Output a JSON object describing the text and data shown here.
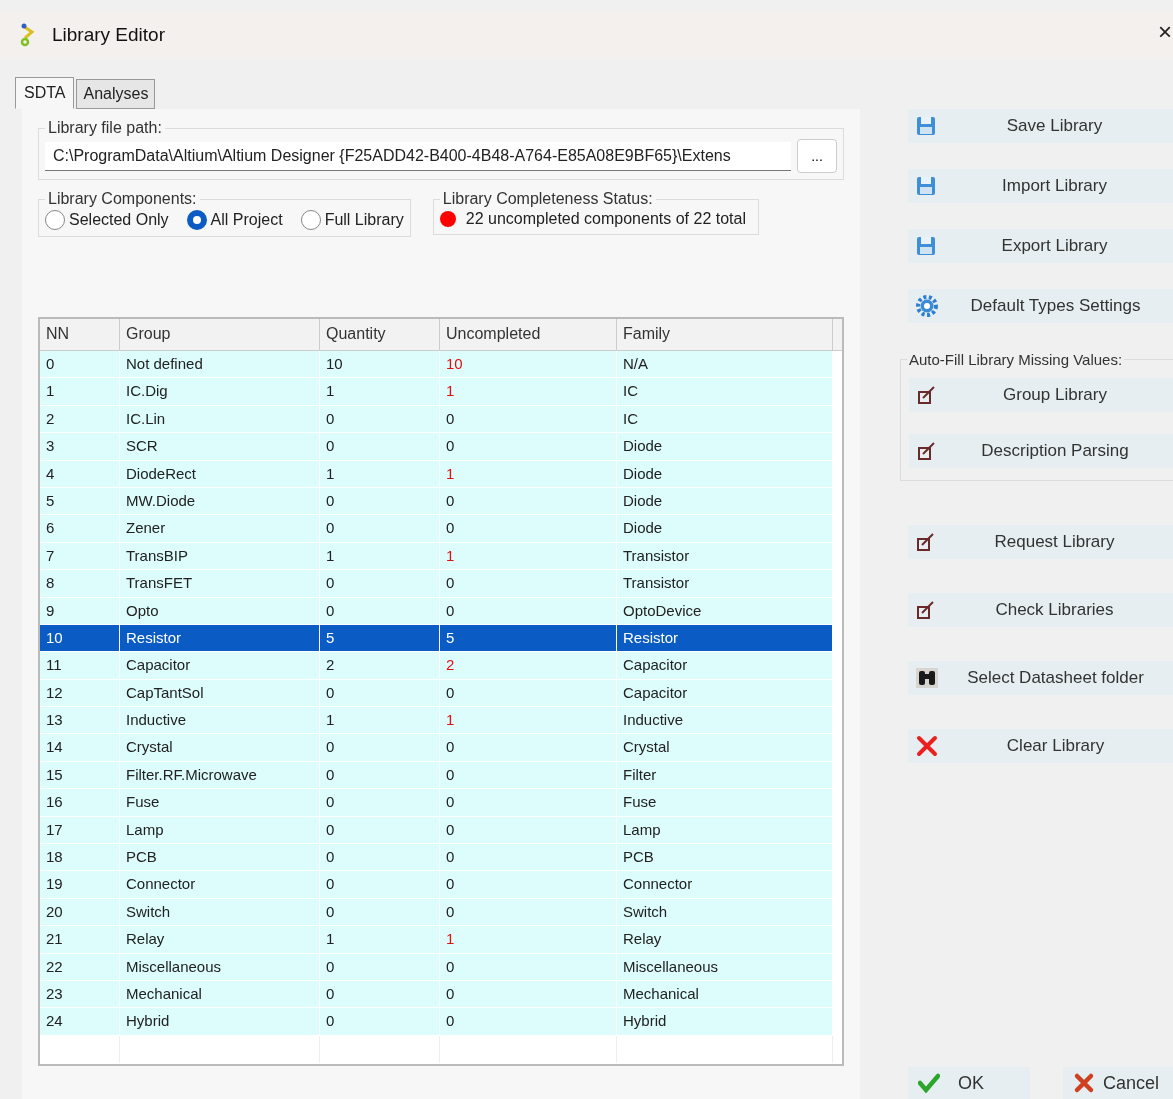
{
  "window": {
    "title": "Library Editor",
    "close": "×"
  },
  "tabs": [
    {
      "label": "SDTA",
      "selected": true
    },
    {
      "label": "Analyses",
      "selected": false
    }
  ],
  "file_path": {
    "label": "Library file path:",
    "value": "C:\\ProgramData\\Altium\\Altium Designer {F25ADD42-B400-4B48-A764-E85A08E9BF65}\\Extens",
    "browse": "..."
  },
  "components": {
    "label": "Library Components:",
    "options": [
      {
        "label": "Selected Only",
        "selected": false
      },
      {
        "label": "All Project",
        "selected": true
      },
      {
        "label": "Full Library",
        "selected": false
      }
    ]
  },
  "status": {
    "label": "Library Completeness Status:",
    "text": "22 uncompleted components of 22 total",
    "color": "#ff0000"
  },
  "table": {
    "columns": [
      "NN",
      "Group",
      "Quantity",
      "Uncompleted",
      "Family"
    ],
    "rows": [
      {
        "cells": [
          "0",
          "Not defined",
          "10",
          "10",
          "N/A"
        ],
        "flagged": true,
        "selected": false
      },
      {
        "cells": [
          "1",
          "IC.Dig",
          "1",
          "1",
          "IC"
        ],
        "flagged": true,
        "selected": false
      },
      {
        "cells": [
          "2",
          "IC.Lin",
          "0",
          "0",
          "IC"
        ],
        "flagged": false,
        "selected": false
      },
      {
        "cells": [
          "3",
          "SCR",
          "0",
          "0",
          "Diode"
        ],
        "flagged": false,
        "selected": false
      },
      {
        "cells": [
          "4",
          "DiodeRect",
          "1",
          "1",
          "Diode"
        ],
        "flagged": true,
        "selected": false
      },
      {
        "cells": [
          "5",
          "MW.Diode",
          "0",
          "0",
          "Diode"
        ],
        "flagged": false,
        "selected": false
      },
      {
        "cells": [
          "6",
          "Zener",
          "0",
          "0",
          "Diode"
        ],
        "flagged": false,
        "selected": false
      },
      {
        "cells": [
          "7",
          "TransBIP",
          "1",
          "1",
          "Transistor"
        ],
        "flagged": true,
        "selected": false
      },
      {
        "cells": [
          "8",
          "TransFET",
          "0",
          "0",
          "Transistor"
        ],
        "flagged": false,
        "selected": false
      },
      {
        "cells": [
          "9",
          "Opto",
          "0",
          "0",
          "OptoDevice"
        ],
        "flagged": false,
        "selected": false
      },
      {
        "cells": [
          "10",
          "Resistor",
          "5",
          "5",
          "Resistor"
        ],
        "flagged": true,
        "selected": true
      },
      {
        "cells": [
          "11",
          "Capacitor",
          "2",
          "2",
          "Capacitor"
        ],
        "flagged": true,
        "selected": false
      },
      {
        "cells": [
          "12",
          "CapTantSol",
          "0",
          "0",
          "Capacitor"
        ],
        "flagged": false,
        "selected": false
      },
      {
        "cells": [
          "13",
          "Inductive",
          "1",
          "1",
          "Inductive"
        ],
        "flagged": true,
        "selected": false
      },
      {
        "cells": [
          "14",
          "Crystal",
          "0",
          "0",
          "Crystal"
        ],
        "flagged": false,
        "selected": false
      },
      {
        "cells": [
          "15",
          "Filter.RF.Microwave",
          "0",
          "0",
          "Filter"
        ],
        "flagged": false,
        "selected": false
      },
      {
        "cells": [
          "16",
          "Fuse",
          "0",
          "0",
          "Fuse"
        ],
        "flagged": false,
        "selected": false
      },
      {
        "cells": [
          "17",
          "Lamp",
          "0",
          "0",
          "Lamp"
        ],
        "flagged": false,
        "selected": false
      },
      {
        "cells": [
          "18",
          "PCB",
          "0",
          "0",
          "PCB"
        ],
        "flagged": false,
        "selected": false
      },
      {
        "cells": [
          "19",
          "Connector",
          "0",
          "0",
          "Connector"
        ],
        "flagged": false,
        "selected": false
      },
      {
        "cells": [
          "20",
          "Switch",
          "0",
          "0",
          "Switch"
        ],
        "flagged": false,
        "selected": false
      },
      {
        "cells": [
          "21",
          "Relay",
          "1",
          "1",
          "Relay"
        ],
        "flagged": true,
        "selected": false
      },
      {
        "cells": [
          "22",
          "Miscellaneous",
          "0",
          "0",
          "Miscellaneous"
        ],
        "flagged": false,
        "selected": false
      },
      {
        "cells": [
          "23",
          "Mechanical",
          "0",
          "0",
          "Mechanical"
        ],
        "flagged": false,
        "selected": false
      },
      {
        "cells": [
          "24",
          "Hybrid",
          "0",
          "0",
          "Hybrid"
        ],
        "flagged": false,
        "selected": false
      }
    ]
  },
  "actions": [
    {
      "label": "Save Library",
      "kind": "disk"
    },
    {
      "label": "Import Library",
      "kind": "disk"
    },
    {
      "label": "Export Library",
      "kind": "disk"
    },
    {
      "label": "Default Types Settings",
      "kind": "gear"
    }
  ],
  "auto_fill": {
    "label": "Auto-Fill Library Missing Values:",
    "buttons": [
      {
        "label": "Group Library",
        "kind": "edit"
      },
      {
        "label": "Description Parsing",
        "kind": "edit"
      }
    ]
  },
  "tools": [
    {
      "label": "Request Library",
      "kind": "edit"
    },
    {
      "label": "Check Libraries",
      "kind": "edit"
    },
    {
      "label": "Select Datasheet folder",
      "kind": "binoculars"
    },
    {
      "label": "Clear Library",
      "kind": "cross"
    }
  ],
  "dialog_buttons": [
    {
      "label": "OK",
      "kind": "check"
    },
    {
      "label": "Cancel",
      "kind": "cancel"
    }
  ]
}
